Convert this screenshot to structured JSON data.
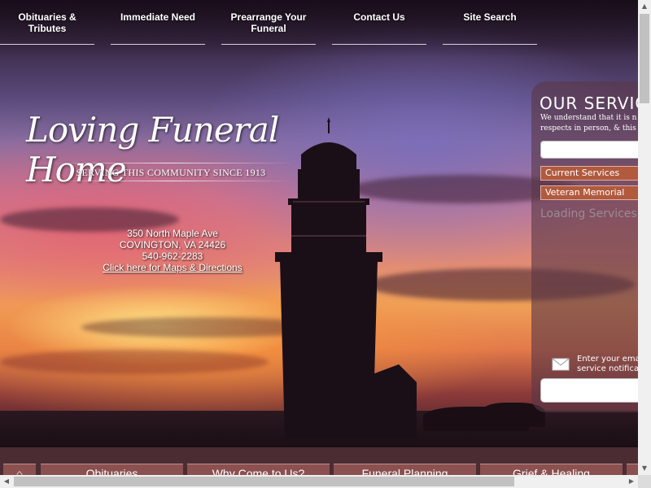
{
  "nav": {
    "items": [
      {
        "label": "Obituaries & Tributes"
      },
      {
        "label": "Immediate Need"
      },
      {
        "label": "Prearrange Your Funeral"
      },
      {
        "label": "Contact Us"
      },
      {
        "label": "Site Search"
      }
    ]
  },
  "logo": {
    "name": "Loving Funeral Home",
    "tagline": "SERVING THIS COMMUNITY SINCE 1913"
  },
  "address": {
    "street": "350 North Maple Ave",
    "city": "COVINGTON, VA 24426",
    "phone": "540-962-2283",
    "directions_link": "Click here for Maps & Directions"
  },
  "services_panel": {
    "title": "OUR SERVIC",
    "description_line1": "We understand that it is n",
    "description_line2": "respects in person, & this",
    "search_placeholder": "",
    "current_services_label": "Current Services",
    "veteran_memorial_label": "Veteran Memorial",
    "loading_text": "Loading Services",
    "email_prompt_line1": "Enter your ema",
    "email_prompt_line2": "service notifica",
    "email_placeholder": ""
  },
  "bottom_nav": {
    "home_icon_label": "⌂",
    "items": [
      {
        "label": "Obituaries"
      },
      {
        "label": "Why Come to Us?"
      },
      {
        "label": "Funeral Planning"
      },
      {
        "label": "Grief & Healing"
      }
    ]
  },
  "colors": {
    "accent_button": "#b15a3e",
    "panel_background": "#5a3746",
    "bottom_bar": "#4b2c33",
    "bottom_tab": "#8b5050"
  }
}
